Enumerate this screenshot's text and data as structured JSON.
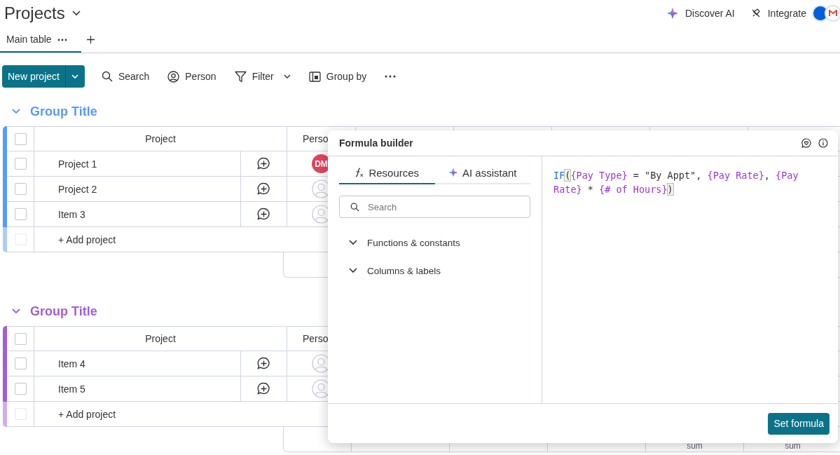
{
  "board": {
    "title": "Projects"
  },
  "views": [
    {
      "label": "Main table",
      "selected": true
    }
  ],
  "header_actions": [
    {
      "label": "Discover AI",
      "kind": "ai"
    },
    {
      "label": "Integrate",
      "kind": "integrate"
    }
  ],
  "toolbar": {
    "primary": "New project",
    "items": [
      {
        "label": "Search",
        "kind": "search"
      },
      {
        "label": "Person",
        "kind": "person"
      },
      {
        "label": "Filter",
        "kind": "filter"
      },
      {
        "label": "Group by",
        "kind": "group"
      }
    ]
  },
  "groups": [
    {
      "title": "Group Title",
      "color": "#579bfc",
      "all_checked": false,
      "columns": [
        "Project",
        "Perso"
      ],
      "rows": [
        {
          "name": "Project 1",
          "checked": false,
          "person": "DM"
        },
        {
          "name": "Project 2",
          "checked": false
        },
        {
          "name": "Item 3",
          "checked": false
        }
      ],
      "add_label": "+ Add project",
      "add_disabled": true
    },
    {
      "title": "Group Title",
      "color": "#a25ddc",
      "all_checked": false,
      "columns": [
        "Project",
        "Perso"
      ],
      "rows": [
        {
          "name": "Item 4",
          "checked": false
        },
        {
          "name": "Item 5",
          "checked": false
        }
      ],
      "add_label": "+ Add project",
      "add_disabled": true,
      "sums": [
        "sum",
        "sum"
      ]
    }
  ],
  "formula_builder": {
    "title": "Formula builder",
    "tabs": [
      {
        "label": "Resources",
        "kind": "resources",
        "selected": true
      },
      {
        "label": "AI assistant",
        "kind": "ai",
        "selected": false
      }
    ],
    "search": {
      "placeholder": "Search"
    },
    "sections": [
      {
        "label": "Functions & constants",
        "expanded": false
      },
      {
        "label": "Columns & labels",
        "expanded": false
      }
    ],
    "formula": [
      {
        "kind": "function",
        "text": "IF"
      },
      {
        "kind": "paren",
        "text": "("
      },
      {
        "kind": "field",
        "text": "{Pay Type}"
      },
      {
        "kind": "plain",
        "text": " = "
      },
      {
        "kind": "string",
        "text": "\"By Appt\""
      },
      {
        "kind": "plain",
        "text": ", "
      },
      {
        "kind": "field",
        "text": "{Pay Rate}"
      },
      {
        "kind": "plain",
        "text": ", "
      },
      {
        "kind": "field",
        "text": "{Pay Rate}"
      },
      {
        "kind": "plain",
        "text": " * "
      },
      {
        "kind": "field",
        "text": "{# of Hours}"
      },
      {
        "kind": "paren",
        "text": ")"
      }
    ],
    "button": "Set formula"
  }
}
